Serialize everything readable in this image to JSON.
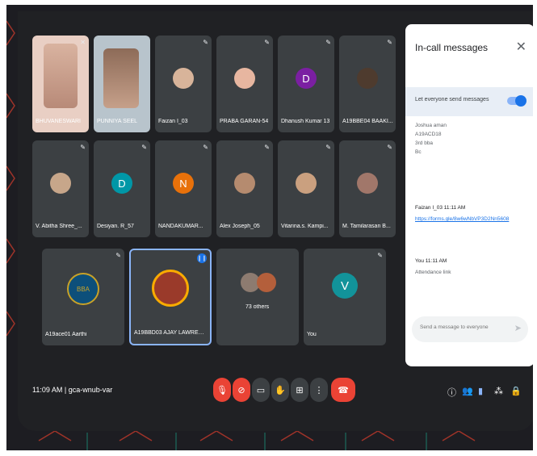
{
  "meeting": {
    "time": "11:09 AM",
    "code": "gca-wnub-var"
  },
  "participants": [
    {
      "name": "BHUVANESWARI",
      "kind": "photo"
    },
    {
      "name": "PUNNIYA SEEL",
      "kind": "photo"
    },
    {
      "name": "Faizan I_03",
      "kind": "avatar"
    },
    {
      "name": "PRABA GARAN-54",
      "kind": "avatar"
    },
    {
      "name": "Dhanush Kumar 13",
      "kind": "letter",
      "letter": "D",
      "color": "#7b1fa2"
    },
    {
      "name": "A19BBE04 BAAKI...",
      "kind": "avatar"
    },
    {
      "name": "V. Abitha Shree_...",
      "kind": "avatar"
    },
    {
      "name": "Desiyan. R_57",
      "kind": "letter",
      "letter": "D",
      "color": "#0097a7"
    },
    {
      "name": "NANDAKUMAR...",
      "kind": "letter",
      "letter": "N",
      "color": "#e8710a"
    },
    {
      "name": "Alex Joseph_05",
      "kind": "avatar"
    },
    {
      "name": "Vitarina.s. Kampi...",
      "kind": "avatar"
    },
    {
      "name": "M. Tamilarasan B...",
      "kind": "avatar"
    },
    {
      "name": "A19ace01 Aarthi",
      "kind": "logo",
      "logo_text": "BBA"
    },
    {
      "name": "A19BBD03 AJAY LAWRENC...",
      "kind": "avatar",
      "speaking": true
    },
    {
      "name": "73 others",
      "kind": "group"
    },
    {
      "name": "You",
      "kind": "letter",
      "letter": "V",
      "color": "#12939a"
    }
  ],
  "chat": {
    "title": "In-call messages",
    "toggle_label": "Let everyone send messages",
    "msg_lines": [
      "Joshua aman",
      "A19ACD18",
      "3rd bba",
      "Bc"
    ],
    "faizan_header": "Faizan I_03  11:11 AM",
    "faizan_link": "https://forms.gle/8w6wNbVP3D2Nn5608",
    "you_header": "You  11:11 AM",
    "you_msg": "Attendance link",
    "compose_placeholder": "Send a message to everyone"
  },
  "colors": {
    "background": "#202124",
    "tile": "#3c4043",
    "accent_red": "#ea4335",
    "accent_blue": "#1a73e8",
    "active_border": "#8ab4f8"
  }
}
